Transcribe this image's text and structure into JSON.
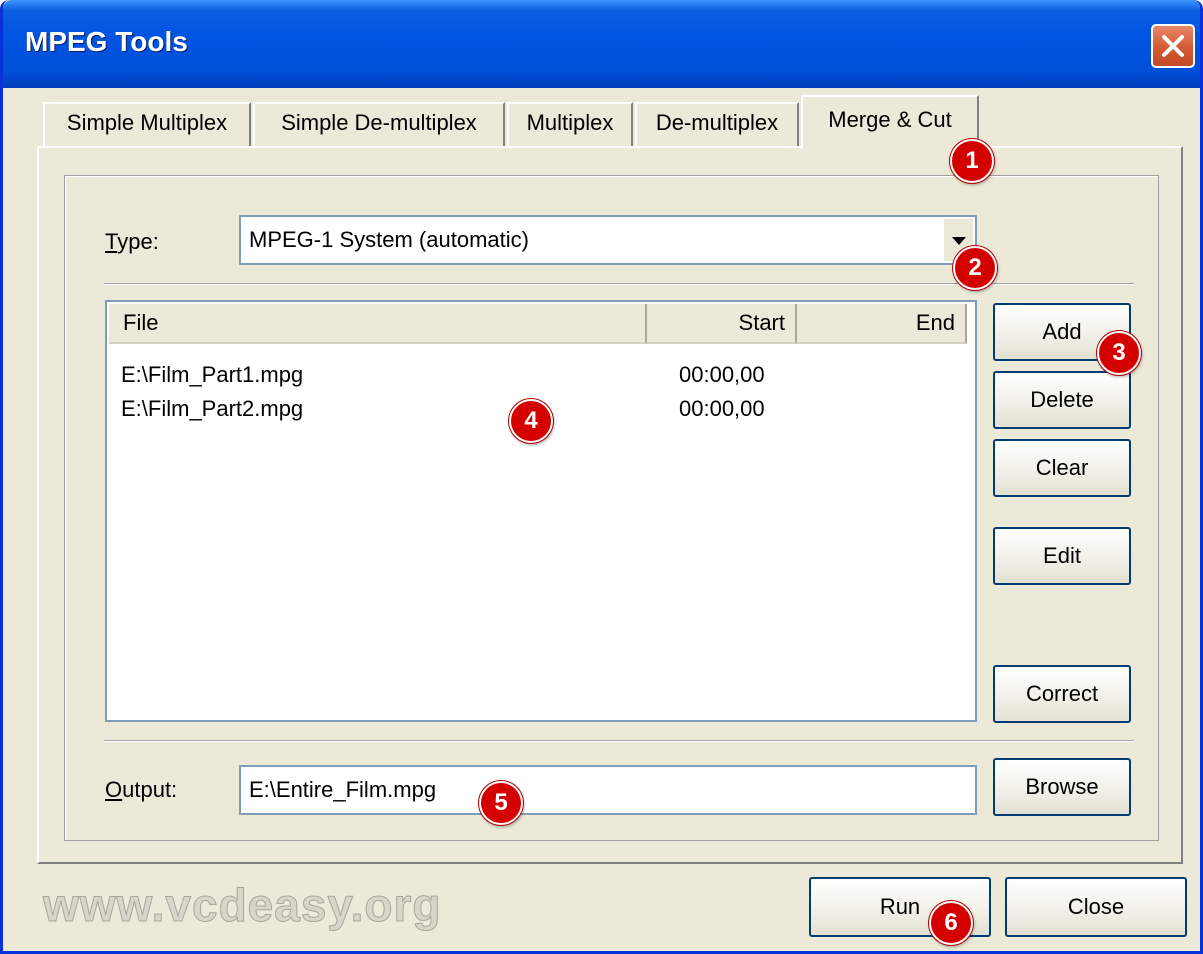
{
  "window": {
    "title": "MPEG Tools"
  },
  "tabs": [
    {
      "label": "Simple Multiplex"
    },
    {
      "label": "Simple De-multiplex"
    },
    {
      "label": "Multiplex"
    },
    {
      "label": "De-multiplex"
    },
    {
      "label": "Merge & Cut",
      "selected": true
    }
  ],
  "type_field": {
    "label_hotkey": "T",
    "label_rest": "ype:",
    "value": "MPEG-1 System (automatic)"
  },
  "file_list": {
    "columns": [
      "File",
      "Start",
      "End"
    ],
    "rows": [
      {
        "file": "E:\\Film_Part1.mpg",
        "start": "00:00,00",
        "end": ""
      },
      {
        "file": "E:\\Film_Part2.mpg",
        "start": "00:00,00",
        "end": ""
      }
    ]
  },
  "side_buttons": {
    "add": "Add",
    "delete": "Delete",
    "clear": "Clear",
    "edit": "Edit",
    "correct": "Correct"
  },
  "output_field": {
    "label_hotkey": "O",
    "label_rest": "utput:",
    "value": "E:\\Entire_Film.mpg",
    "browse": "Browse"
  },
  "footer": {
    "run": "Run",
    "close": "Close",
    "watermark": "www.vcdeasy.org"
  },
  "callouts": [
    "1",
    "2",
    "3",
    "4",
    "5",
    "6"
  ],
  "colors": {
    "titlebar": "#0054e3",
    "dialog_face": "#ece9d8",
    "callout_badge": "#d40000",
    "close_button": "#d45a34"
  }
}
